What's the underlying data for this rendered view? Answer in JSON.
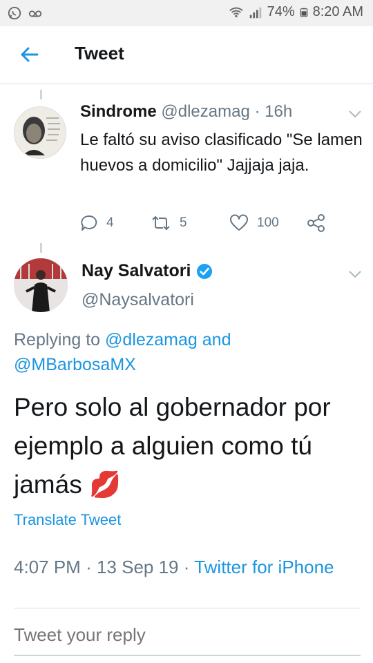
{
  "status_bar": {
    "battery": "74%",
    "time": "8:20 AM",
    "left_icons": [
      "whatsapp-icon",
      "voicemail-icon"
    ],
    "right_icons": [
      "wifi-icon",
      "signal-icon",
      "battery-icon"
    ]
  },
  "header": {
    "title": "Tweet",
    "back_icon": "back-arrow-icon"
  },
  "tweet1": {
    "name": "Sindrome",
    "handle": "@dlezamag",
    "time_sep": "·",
    "time": "16h",
    "text": "Le faltó su aviso clasificado \"Se lamen huevos a domicilio\" Jajjaja jaja.",
    "replies": "4",
    "retweets": "5",
    "likes": "100"
  },
  "tweet2": {
    "name": "Nay Salvatori",
    "verified": true,
    "handle": "@Naysalvatori",
    "replying_prefix": "Replying to",
    "reply_to_1": "@dlezamag",
    "reply_and": "and",
    "reply_to_2": "@MBarbosaMX",
    "text": "Pero solo al gobernador por ejemplo a alguien como tú jamás",
    "emoji": "💋",
    "translate": "Translate Tweet",
    "time": "4:07 PM",
    "date": "13 Sep 19",
    "source": "Twitter for iPhone",
    "sep": "·"
  },
  "reply_box": {
    "placeholder": "Tweet your reply"
  },
  "colors": {
    "accent": "#1b95e0",
    "muted": "#657786",
    "text": "#14171a",
    "divider": "#d8dde1",
    "like_red": "#e0245e"
  }
}
